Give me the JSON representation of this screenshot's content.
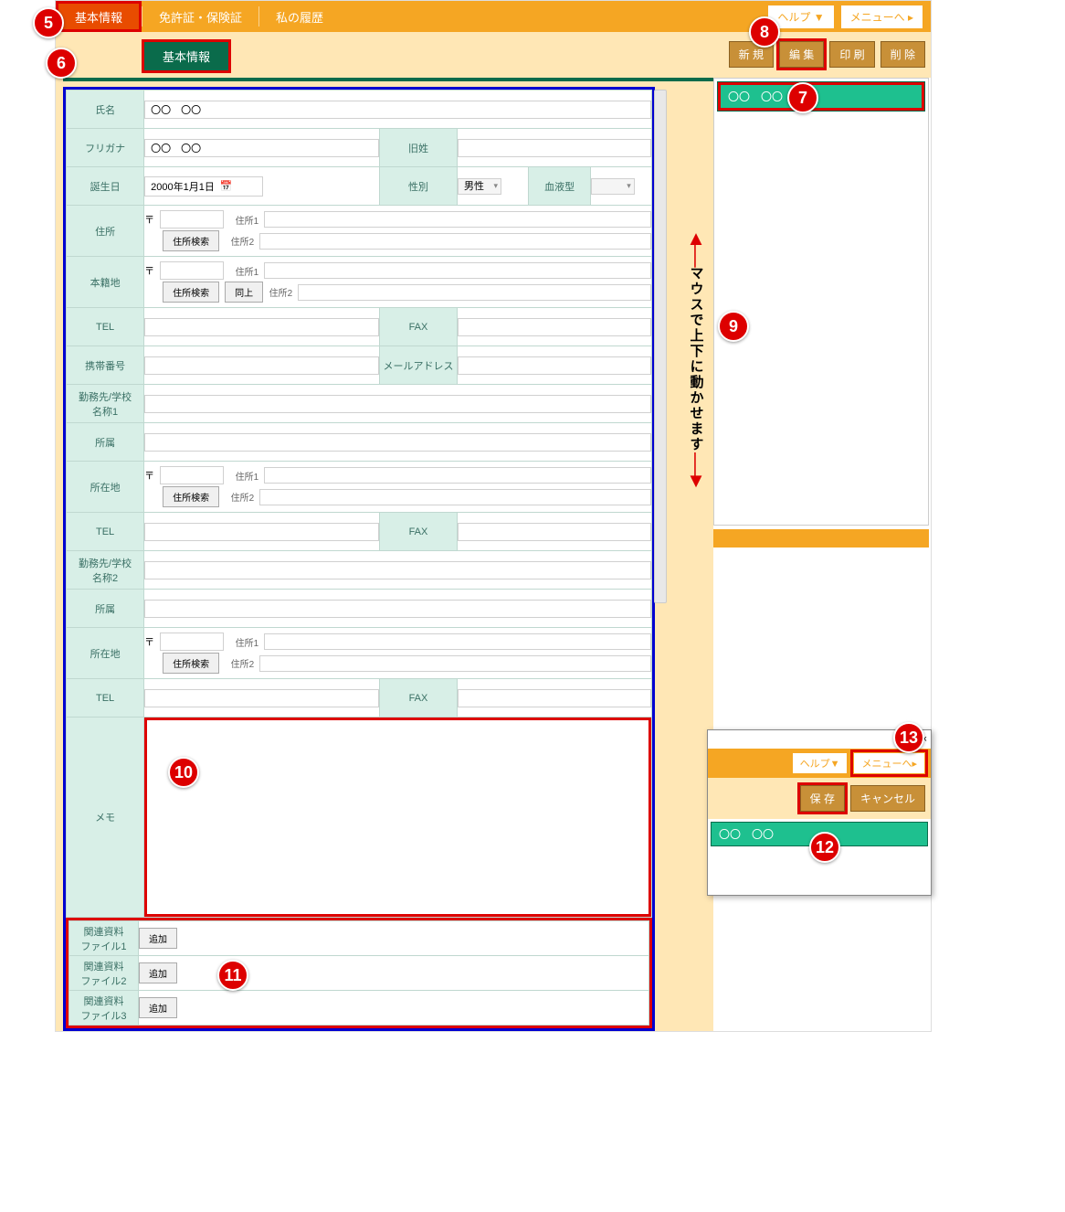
{
  "nav": {
    "tabs": [
      "基本情報",
      "免許証・保険証",
      "私の履歴"
    ],
    "help": "ヘルプ ▼",
    "menu": "メニューへ ▸"
  },
  "subtab": "基本情報",
  "actions": {
    "new": "新 規",
    "edit": "編 集",
    "print": "印 刷",
    "delete": "削 除"
  },
  "side_record": "〇〇　〇〇",
  "form": {
    "name_lbl": "氏名",
    "name_val": "〇〇　〇〇",
    "kana_lbl": "フリガナ",
    "kana_val": "〇〇　〇〇",
    "maiden_lbl": "旧姓",
    "birth_lbl": "誕生日",
    "birth_val": "2000年1月1日",
    "sex_lbl": "性別",
    "sex_val": "男性",
    "blood_lbl": "血液型",
    "addr_lbl": "住所",
    "honseki_lbl": "本籍地",
    "postal_mark": "〒",
    "addr_search": "住所検索",
    "ditto": "同上",
    "addr1": "住所1",
    "addr2": "住所2",
    "tel_lbl": "TEL",
    "fax_lbl": "FAX",
    "mobile_lbl": "携帯番号",
    "mail_lbl": "メールアドレス",
    "work1_lbl": "勤務先/学校\n名称1",
    "work2_lbl": "勤務先/学校\n名称2",
    "dept_lbl": "所属",
    "loc_lbl": "所在地",
    "memo_lbl": "メモ",
    "file1": "関連資料\nファイル1",
    "file2": "関連資料\nファイル2",
    "file3": "関連資料\nファイル3",
    "add_btn": "追加"
  },
  "scroll_hint": "マウスで上下に動かせます",
  "popup": {
    "help": "ヘルプ▼",
    "menu": "メニューへ▸",
    "save": "保 存",
    "cancel": "キャンセル",
    "record": "〇〇　〇〇",
    "min": "—",
    "close": "×"
  },
  "callouts": {
    "c5": "5",
    "c6": "6",
    "c7": "7",
    "c8": "8",
    "c9": "9",
    "c10": "10",
    "c11": "11",
    "c12": "12",
    "c13": "13"
  }
}
